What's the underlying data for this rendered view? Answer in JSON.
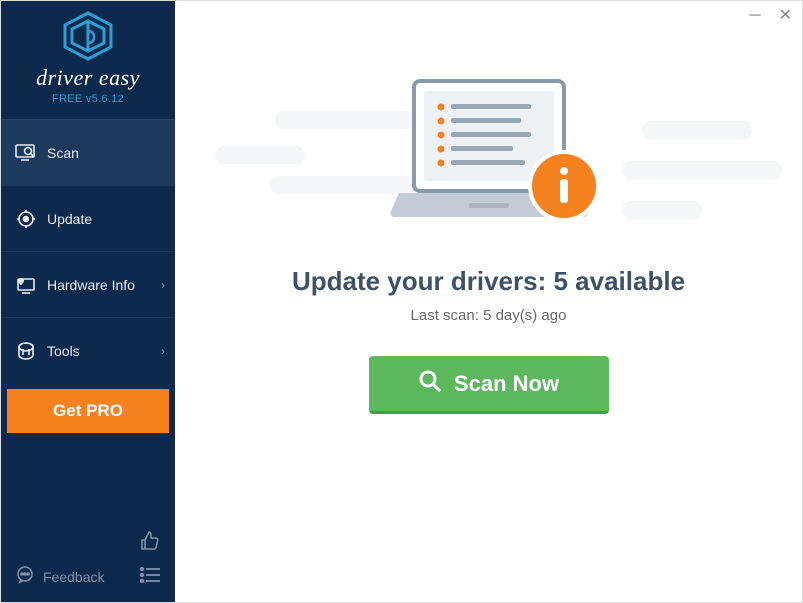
{
  "brand": {
    "name": "driver easy",
    "version": "FREE v5.6.12"
  },
  "nav": {
    "scan": {
      "label": "Scan"
    },
    "update": {
      "label": "Update"
    },
    "hw": {
      "label": "Hardware Info"
    },
    "tools": {
      "label": "Tools"
    }
  },
  "cta": {
    "getpro": "Get PRO"
  },
  "footer": {
    "feedback": "Feedback"
  },
  "main": {
    "headline_prefix": "Update your drivers: ",
    "available_count": "5",
    "headline_suffix": " available",
    "lastscan_prefix": "Last scan: ",
    "lastscan_value": "5 day(s) ago",
    "button": "Scan Now"
  }
}
